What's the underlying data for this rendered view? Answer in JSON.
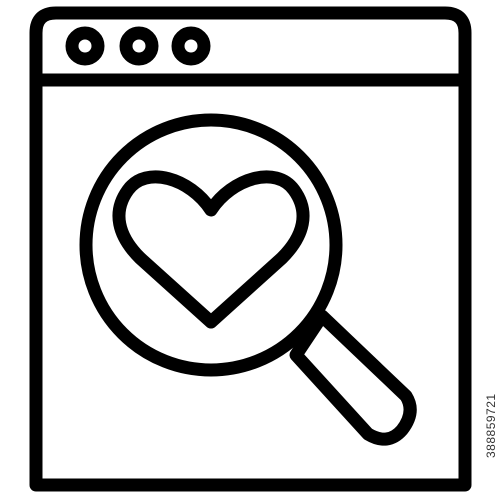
{
  "icon": {
    "name": "browser-window-love-search-icon",
    "stroke_color": "#000000",
    "background": "#ffffff"
  },
  "window": {
    "control_dots": [
      "window-dot",
      "window-dot",
      "window-dot"
    ]
  },
  "watermark": {
    "stock_id": "388859721"
  }
}
